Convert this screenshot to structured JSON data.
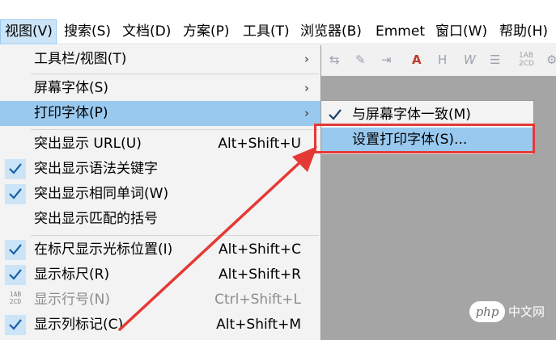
{
  "menubar": {
    "items": [
      "视图(V)",
      "搜索(S)",
      "文档(D)",
      "方案(P)",
      "工具(T)",
      "浏览器(B)",
      "Emmet",
      "窗口(W)",
      "帮助(H)"
    ]
  },
  "menu": {
    "toolbar_view": "工具栏/视图(T)",
    "screen_font": "屏幕字体(S)",
    "print_font": "打印字体(P)",
    "highlight_url": "突出显示 URL(U)",
    "highlight_url_shortcut": "Alt+Shift+U",
    "highlight_keywords": "突出显示语法关键字",
    "highlight_same_words": "突出显示相同单词(W)",
    "highlight_brackets": "突出显示匹配的括号",
    "ruler_cursor": "在标尺显示光标位置(I)",
    "ruler_cursor_shortcut": "Alt+Shift+C",
    "show_ruler": "显示标尺(R)",
    "show_ruler_shortcut": "Alt+Shift+R",
    "show_line_numbers": "显示行号(N)",
    "show_line_numbers_shortcut": "Ctrl+Shift+L",
    "show_column_markers": "显示列标记(C)",
    "show_column_markers_shortcut": "Alt+Shift+M",
    "line_icon": "1AB 2CD"
  },
  "submenu": {
    "same_as_screen": "与屏幕字体一致(M)",
    "set_print_font": "设置打印字体(S)..."
  },
  "toolbar": {
    "icons": [
      "tab-icon",
      "pen-icon",
      "indent-icon",
      "font-color-icon",
      "heading-icon",
      "italic-icon",
      "list-icon",
      "line-number-icon"
    ]
  },
  "watermark": {
    "logo": "php",
    "text": "中文网"
  },
  "colors": {
    "highlight": "#99c9ef",
    "check_bg": "#cce4f7",
    "annotation_red": "#e53935",
    "workspace": "#a5a5a5"
  }
}
